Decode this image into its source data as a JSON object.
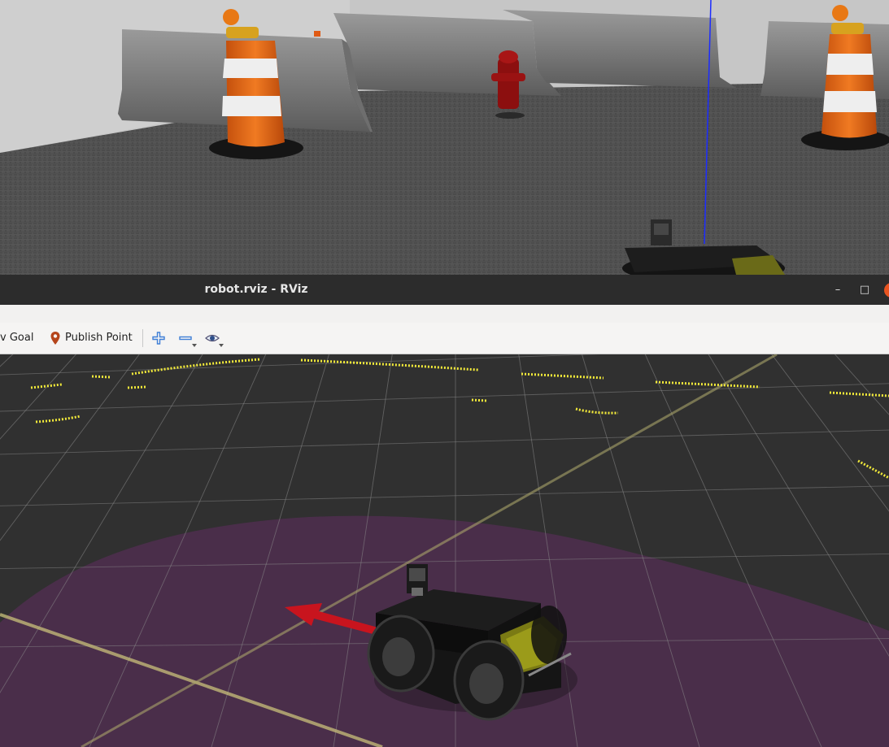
{
  "window": {
    "title": "robot.rviz - RViz",
    "minimize_glyph": "–",
    "maximize_glyph": "□"
  },
  "toolbar": {
    "nav_goal_label": "v Goal",
    "publish_point_label": "Publish Point",
    "icons": [
      "map-pin-icon",
      "zoom-in-icon",
      "zoom-out-icon",
      "eye-icon"
    ]
  },
  "colors": {
    "grid_bg": "#303030",
    "grid_line": "#8a8a8a",
    "costmap": "#4a2e4a",
    "laser": "#f2ea3a",
    "x_axis_arrow": "#c8141e",
    "titlebar": "#2c2c2c",
    "close_button": "#e95420"
  }
}
